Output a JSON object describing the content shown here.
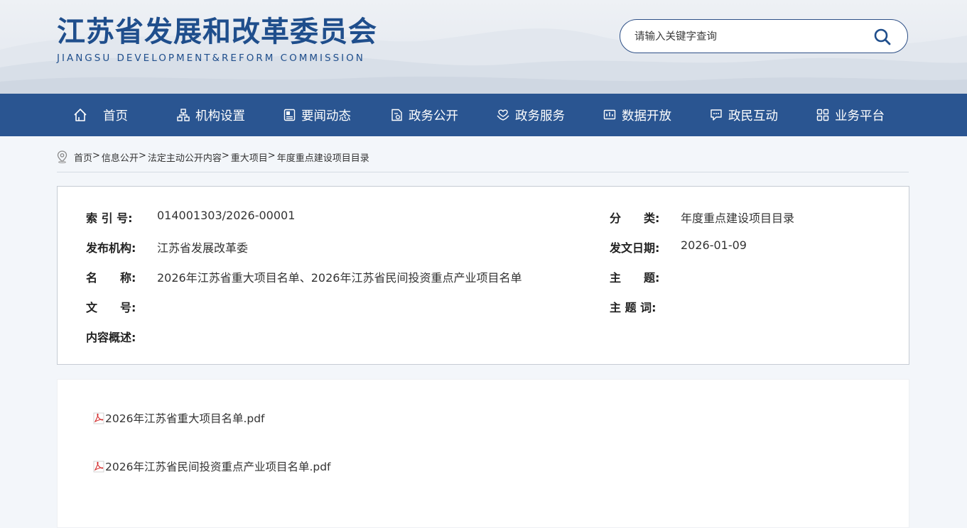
{
  "header": {
    "title_cn": "江苏省发展和改革委员会",
    "title_en": "JIANGSU DEVELOPMENT&REFORM COMMISSION",
    "search_placeholder": "请输入关键字查询"
  },
  "nav": {
    "items": [
      {
        "label": "首页",
        "icon": "home-icon"
      },
      {
        "label": "机构设置",
        "icon": "org-chart-icon"
      },
      {
        "label": "要闻动态",
        "icon": "news-icon"
      },
      {
        "label": "政务公开",
        "icon": "document-icon"
      },
      {
        "label": "政务服务",
        "icon": "service-hands-icon"
      },
      {
        "label": "数据开放",
        "icon": "data-icon"
      },
      {
        "label": "政民互动",
        "icon": "chat-icon"
      },
      {
        "label": "业务平台",
        "icon": "grid-icon"
      }
    ]
  },
  "breadcrumb": {
    "items": [
      "首页",
      "信息公开",
      "法定主动公开内容",
      "重大项目",
      "年度重点建设项目目录"
    ],
    "separator": ">"
  },
  "meta": {
    "index_label": "索 引 号:",
    "index_value": "014001303/2026-00001",
    "category_label": "分　　类:",
    "category_value": "年度重点建设项目目录",
    "publisher_label": "发布机构:",
    "publisher_value": "江苏省发展改革委",
    "date_label": "发文日期:",
    "date_value": "2026-01-09",
    "name_label": "名　　称:",
    "name_value": "2026年江苏省重大项目名单、2026年江苏省民间投资重点产业项目名单",
    "subject_label": "主　　题:",
    "subject_value": "",
    "docno_label": "文　　号:",
    "docno_value": "",
    "keywords_label": "主 题 词:",
    "keywords_value": "",
    "summary_label": "内容概述:",
    "summary_value": ""
  },
  "attachments": [
    {
      "name": "2026年江苏省重大项目名单.pdf",
      "icon": "pdf-icon"
    },
    {
      "name": "2026年江苏省民间投资重点产业项目名单.pdf",
      "icon": "pdf-icon"
    }
  ],
  "colors": {
    "brand": "#1f4e8c",
    "nav_bg": "#2a5591",
    "page_bg": "#f3f6fa"
  }
}
